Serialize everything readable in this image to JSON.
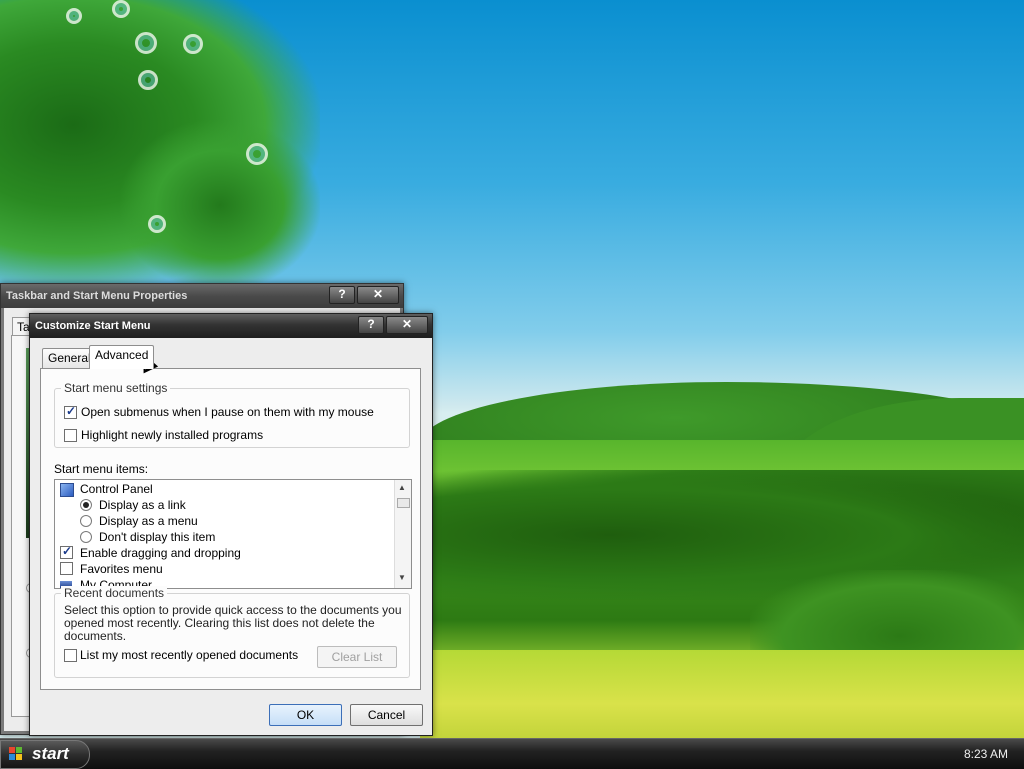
{
  "desktop": {
    "wallpaper": "green-hills-landscape"
  },
  "background_window": {
    "title": "Taskbar and Start Menu Properties",
    "help_button": "?",
    "close_button": "✕",
    "tab_stub": "Ta"
  },
  "dialog": {
    "title": "Customize Start Menu",
    "help_button": "?",
    "close_button": "✕",
    "tabs": [
      {
        "label": "General",
        "active": false
      },
      {
        "label": "Advanced",
        "active": true
      }
    ],
    "start_menu_settings": {
      "legend": "Start menu settings",
      "open_submenus": {
        "label": "Open submenus when I pause on them with my mouse",
        "checked": true
      },
      "highlight_programs": {
        "label": "Highlight newly installed programs",
        "checked": false
      }
    },
    "start_menu_items": {
      "label": "Start menu items:",
      "control_panel": "Control Panel",
      "display_as_link": {
        "label": "Display as a link",
        "selected": true
      },
      "display_as_menu": {
        "label": "Display as a menu",
        "selected": false
      },
      "dont_display": {
        "label": "Don't display this item",
        "selected": false
      },
      "enable_dragging": {
        "label": "Enable dragging and dropping",
        "checked": true
      },
      "favorites_menu": {
        "label": "Favorites menu",
        "checked": false
      },
      "my_computer": "My Computer",
      "scroll_up": "▲",
      "scroll_down": "▼"
    },
    "recent_documents": {
      "legend": "Recent documents",
      "description": "Select this option to provide quick access to the documents you opened most recently.  Clearing this list does not delete the documents.",
      "list_recent": {
        "label": "List my most recently opened documents",
        "checked": false
      },
      "clear_list_button": "Clear List"
    },
    "ok_button": "OK",
    "cancel_button": "Cancel"
  },
  "taskbar": {
    "start_label": "start",
    "clock": "8:23 AM"
  }
}
